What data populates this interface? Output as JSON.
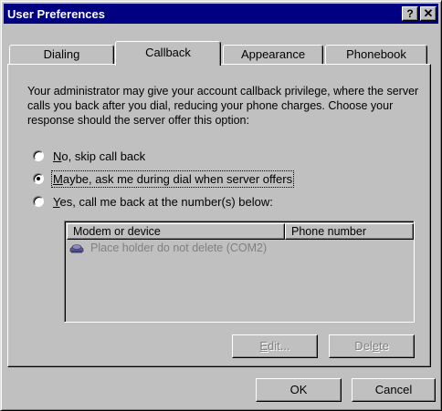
{
  "window": {
    "title": "User Preferences",
    "help_glyph": "?",
    "close_glyph": "✕"
  },
  "tabs": [
    {
      "label": "Dialing"
    },
    {
      "label": "Callback"
    },
    {
      "label": "Appearance"
    },
    {
      "label": "Phonebook"
    }
  ],
  "active_tab": "Callback",
  "description": "Your administrator may give your account callback privilege, where the server calls you back after you dial, reducing your phone charges.  Choose your response should the server offer this option:",
  "options": [
    {
      "accel": "N",
      "rest": "o, skip call back",
      "checked": false
    },
    {
      "accel": "M",
      "rest": "aybe, ask me during dial when server offers",
      "checked": true
    },
    {
      "accel": "Y",
      "rest": "es, call me back at the number(s) below:",
      "checked": false
    }
  ],
  "list": {
    "columns": [
      "Modem or device",
      "Phone number"
    ],
    "rows": [
      {
        "device": "Place holder do not delete (COM2)",
        "phone": "",
        "icon": "modem-icon"
      }
    ]
  },
  "buttons": {
    "edit": {
      "accel": "E",
      "rest": "dit...",
      "disabled": true
    },
    "delete": {
      "pre": "Del",
      "accel": "e",
      "rest": "te",
      "disabled": true
    },
    "ok": "OK",
    "cancel": "Cancel"
  }
}
